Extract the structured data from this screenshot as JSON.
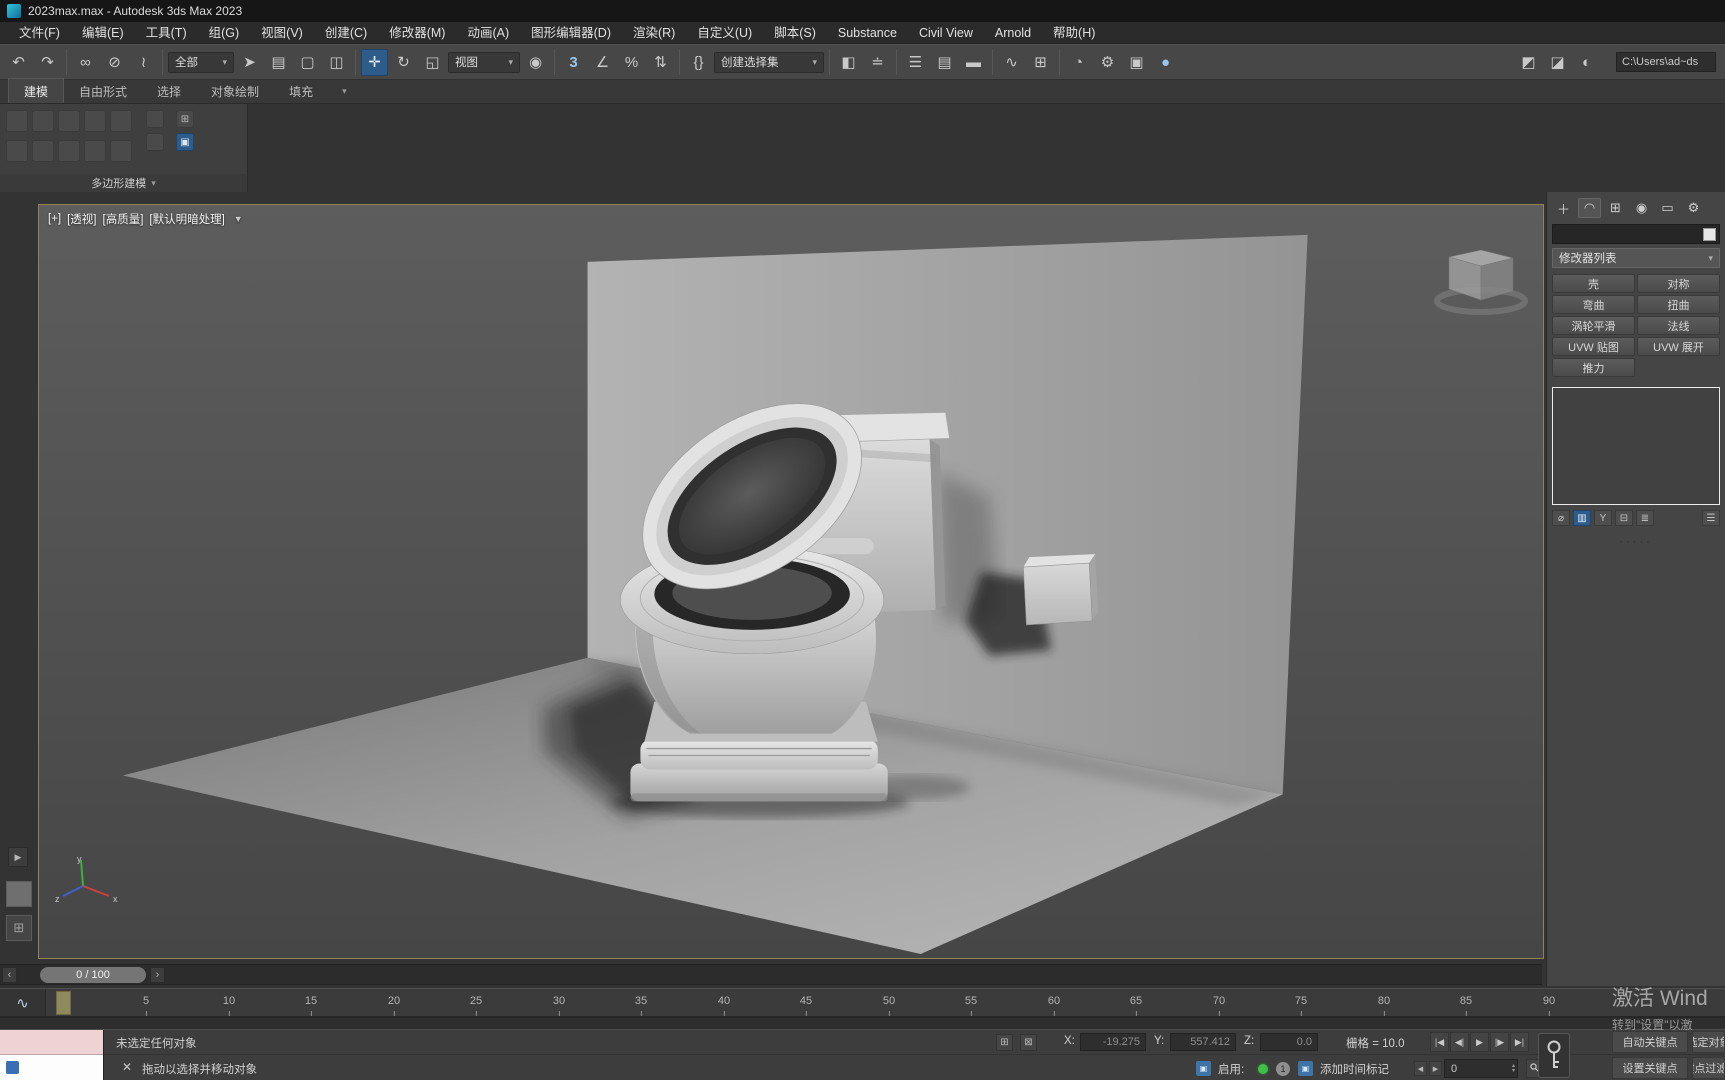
{
  "window": {
    "title": "2023max.max - Autodesk 3ds Max 2023"
  },
  "menu": {
    "items": [
      "文件(F)",
      "编辑(E)",
      "工具(T)",
      "组(G)",
      "视图(V)",
      "创建(C)",
      "修改器(M)",
      "动画(A)",
      "图形编辑器(D)",
      "渲染(R)",
      "自定义(U)",
      "脚本(S)",
      "Substance",
      "Civil View",
      "Arnold",
      "帮助(H)"
    ]
  },
  "toolbar": {
    "selection_filter": "全部",
    "ref_coord": "视图",
    "named_sets": "创建选择集",
    "path_field": "C:\\Users\\ad~ds"
  },
  "ribbon": {
    "tabs": [
      "建模",
      "自由形式",
      "选择",
      "对象绘制",
      "填充"
    ],
    "panel_label": "多边形建模"
  },
  "viewport": {
    "general": "[+]",
    "pov": "[透视]",
    "quality": "[高质量]",
    "shading": "[默认明暗处理]"
  },
  "command_panel": {
    "modifier_list": "修改器列表",
    "buttons": [
      [
        "壳",
        "对称"
      ],
      [
        "弯曲",
        "扭曲"
      ],
      [
        "涡轮平滑",
        "法线"
      ],
      [
        "UVW 贴图",
        "UVW 展开"
      ],
      [
        "推力",
        ""
      ]
    ]
  },
  "timeline": {
    "frame_display": "0 / 100",
    "ticks": [
      "5",
      "10",
      "15",
      "20",
      "25",
      "30",
      "35",
      "40",
      "45",
      "50",
      "55",
      "60",
      "65",
      "70",
      "75",
      "80",
      "85",
      "90"
    ]
  },
  "status": {
    "selection_info": "未选定任何对象",
    "prompt": "拖动以选择并移动对象",
    "x_label": "X:",
    "x_value": "-19.275",
    "y_label": "Y:",
    "y_value": "557.412",
    "z_label": "Z:",
    "z_value": "0.0",
    "grid_label": "栅格 = 10.0",
    "auto_key_label": "自动关键点",
    "set_key_label": "设置关键点",
    "selected_label": "选定对象",
    "key_filters_label": "关键点过滤器..",
    "enable_label": "启用:",
    "layer_badge": "1",
    "add_time_tag_label": "添加时间标记",
    "frame_spinner_value": "0"
  },
  "watermark": {
    "line1": "激活 Wind",
    "line2": "转到\"设置\"以激"
  },
  "colors": {
    "viewport_border": "#8f8455",
    "accent_blue": "#2d5c8a",
    "enable_green": "#3fbf48",
    "panel_gray": "#454545"
  },
  "icons": {
    "caret": "▾",
    "funnel": "▼",
    "close": "✕",
    "dots": "·····",
    "undo": "↶",
    "redo": "↷",
    "link": "∞",
    "unlink": "⊘",
    "bind": "≀",
    "select": "➤",
    "select_by_name": "▤",
    "rect_region": "▢",
    "crossing": "◫",
    "move": "✛",
    "rotate": "↻",
    "scale": "◱",
    "ref_pivot": "◉",
    "snap": "3",
    "angle_snap": "∠",
    "percent_snap": "%",
    "spinner_snap": "⇅",
    "named_sel": "{}",
    "mirror": "◧",
    "align": "≐",
    "scene_explorer": "☰",
    "layer_explorer": "▤",
    "ribbon_toggle": "▬",
    "curve_editor": "∿",
    "schematic": "⊞",
    "material": "◔",
    "render_setup": "⚙",
    "frame_window": "▣",
    "render": "●",
    "extra1": "◩",
    "extra2": "◪",
    "extra3": "◐",
    "strip_arrow": "▶",
    "layout_grid": "⊞",
    "cp_tab_create": "＋",
    "cp_tab_modify": "◠",
    "cp_tab_hierarchy": "⊞",
    "cp_tab_motion": "◉",
    "cp_tab_display": "▭",
    "cp_tab_utilities": "⚙",
    "stack_pin": "⌀",
    "stack_show_end": "▥",
    "stack_unique": "Y",
    "stack_remove": "⊟",
    "stack_configure": "≣",
    "stack_menu": "☰",
    "play_start": "|◀",
    "play_prev": "◀|",
    "play": "▶",
    "play_next": "|▶",
    "play_end": "▶|",
    "slider_prev": "‹",
    "slider_next": "›",
    "abs_offset": "⊞",
    "lock": "⊠",
    "time_icon": "▣",
    "tag_icon": "▣",
    "spin_up": "▴",
    "spin_down": "▾",
    "frame_back": "◀",
    "frame_fwd": "▶",
    "mini_curve": "∿"
  }
}
